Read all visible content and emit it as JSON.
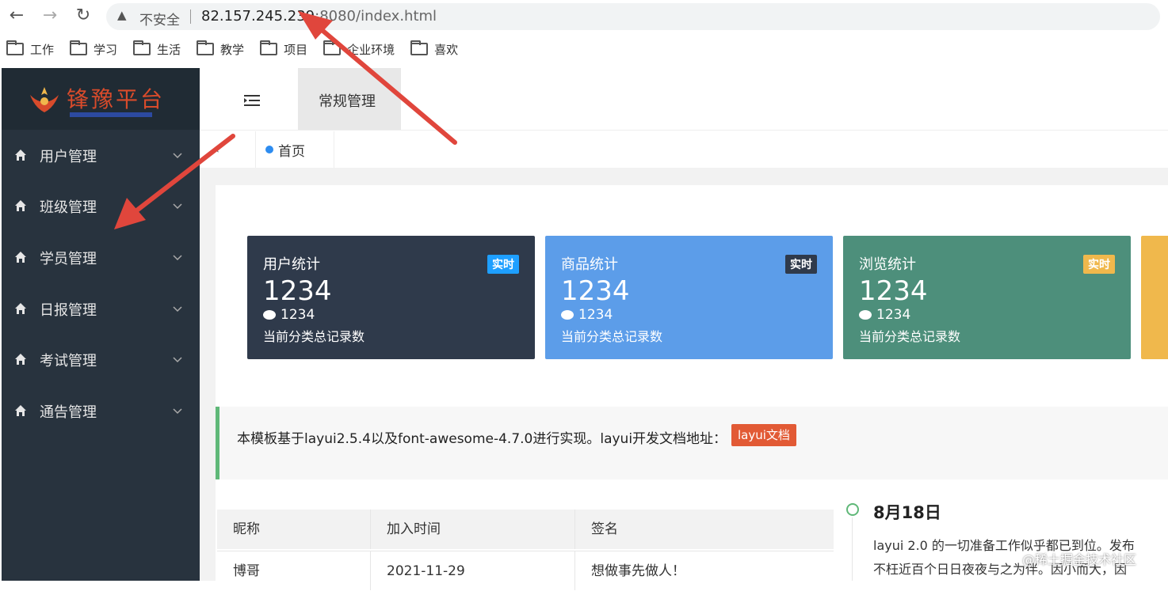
{
  "browser": {
    "insecure_label": "不安全",
    "url_host": "82.157.245.239",
    "url_rest": ":8080/index.html",
    "bookmarks": [
      "工作",
      "学习",
      "生活",
      "教学",
      "项目",
      "企业环境",
      "喜欢"
    ]
  },
  "sidebar": {
    "logo_text": "锋豫平台",
    "items": [
      {
        "label": "用户管理"
      },
      {
        "label": "班级管理"
      },
      {
        "label": "学员管理"
      },
      {
        "label": "日报管理"
      },
      {
        "label": "考试管理"
      },
      {
        "label": "通告管理"
      }
    ]
  },
  "header": {
    "tab_label": "常规管理"
  },
  "page_tabs": {
    "home_label": "首页",
    "prev_symbol": "‹"
  },
  "cards": [
    {
      "title": "用户统计",
      "badge": "实时",
      "number": "1234",
      "sub_number": "1234",
      "desc": "当前分类总记录数",
      "color": "#2f3a4b",
      "badge_color": "#1e9fff"
    },
    {
      "title": "商品统计",
      "badge": "实时",
      "number": "1234",
      "sub_number": "1234",
      "desc": "当前分类总记录数",
      "color": "#5c9de9",
      "badge_color": "#2f3a4b"
    },
    {
      "title": "浏览统计",
      "badge": "实时",
      "number": "1234",
      "sub_number": "1234",
      "desc": "当前分类总记录数",
      "color": "#4d8f7b",
      "badge_color": "#f0b84c"
    }
  ],
  "notice": {
    "text": "本模板基于layui2.5.4以及font-awesome-4.7.0进行实现。layui开发文档地址：",
    "button": "layui文档"
  },
  "table": {
    "headers": [
      "昵称",
      "加入时间",
      "签名"
    ],
    "rows": [
      [
        "博哥",
        "2021-11-29",
        "想做事先做人！"
      ]
    ]
  },
  "timeline": {
    "date": "8月18日",
    "line1": "layui 2.0 的一切准备工作似乎都已到位。发布",
    "line2": "不枉近百个日日夜夜与之为伴。因小而大，因"
  },
  "watermark": "@稀土掘金技术社区"
}
